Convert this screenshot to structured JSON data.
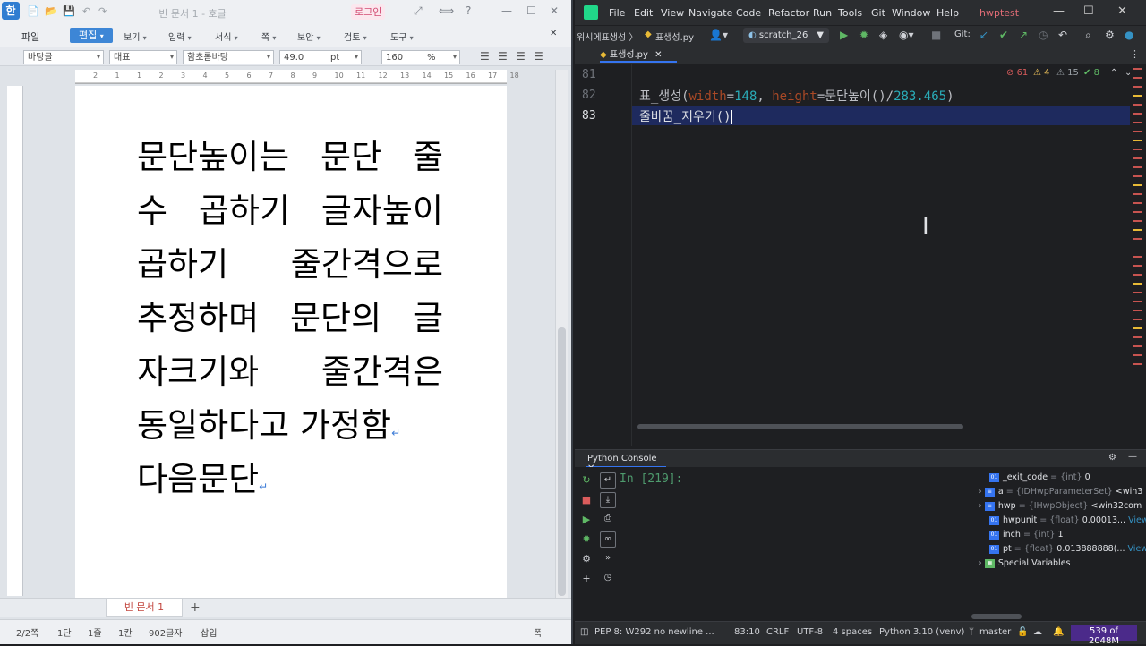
{
  "hwp": {
    "logo": "한",
    "quick_tools": [
      "📄",
      "📂",
      "💾",
      "↶",
      "↷"
    ],
    "doc_title": "빈 문서 1 - 호글",
    "login": "로그인",
    "title_controls": [
      "⤢",
      "⟺",
      "?",
      "—",
      "☐",
      "✕"
    ],
    "menu": [
      "파일",
      "편집",
      "보기",
      "입력",
      "서식",
      "쪽",
      "보안",
      "검토",
      "도구"
    ],
    "toolbar": {
      "style": "바탕글",
      "lang": "대표",
      "font": "함초롬바탕",
      "size": "49.0",
      "size_unit": "pt",
      "zoom_line": "160",
      "zoom_unit": "%"
    },
    "ruler": [
      "2",
      "1",
      "1",
      "2",
      "3",
      "4",
      "5",
      "6",
      "7",
      "8",
      "9",
      "10",
      "11",
      "12",
      "13",
      "14",
      "15",
      "16",
      "17",
      "18"
    ],
    "paragraph1_lines": [
      "문단높이는 문단 줄",
      "수 곱하기 글자높이",
      "곱하기 줄간격으로",
      "추정하며 문단의 글",
      "자크기와 줄간격은",
      "동일하다고 가정함"
    ],
    "paragraph2": "다음문단",
    "para_mark": "↵",
    "tab": "빈 문서 1",
    "tab_add": "+",
    "status": {
      "page": "2/2쪽",
      "section": "1단",
      "line": "1줄",
      "col": "1칸",
      "chars": "902글자",
      "mode": "삽입",
      "width": "폭"
    }
  },
  "pycharm": {
    "menu": [
      "File",
      "Edit",
      "View",
      "Navigate",
      "Code",
      "Refactor",
      "Run",
      "Tools",
      "Git",
      "Window",
      "Help"
    ],
    "project": "hwptest",
    "title_controls": [
      "—",
      "☐",
      "✕"
    ],
    "breadcrumb": "위시에표생성 〉",
    "file_crumb": "표생성.py",
    "run_config": "scratch_26",
    "git_label": "Git:",
    "tab": "표생성.py",
    "tab_close": "✕",
    "issues": {
      "errors": "61",
      "warnings": "4",
      "weak": "15",
      "ok": "8"
    },
    "lines": [
      {
        "num": "81"
      },
      {
        "num": "82"
      },
      {
        "num": "83"
      }
    ],
    "code82": {
      "func": "표_생성(",
      "p1": "width",
      "eq1": "=",
      "v1": "148",
      "comma": ", ",
      "p2": "height",
      "eq2": "=",
      "call": "문단높이()/",
      "v2": "283.465",
      "close": ")"
    },
    "code83": "줄바꿈_지우기()",
    "console": {
      "tab": "Python Console",
      "prompt": "In [219]:"
    },
    "variables": [
      {
        "name": "_exit_code",
        "type": "= {int}",
        "value": "0",
        "view": ""
      },
      {
        "name": "a",
        "type": "= {IDHwpParameterSet}",
        "value": "<win3",
        "view": ""
      },
      {
        "name": "hwp",
        "type": "= {IHwpObject}",
        "value": "<win32com",
        "view": ""
      },
      {
        "name": "hwpunit",
        "type": "= {float}",
        "value": "0.00013...",
        "view": "View"
      },
      {
        "name": "inch",
        "type": "= {int}",
        "value": "1",
        "view": ""
      },
      {
        "name": "pt",
        "type": "= {float}",
        "value": "0.013888888(...",
        "view": "View"
      },
      {
        "name": "Special Variables",
        "type": "",
        "value": "",
        "view": ""
      }
    ],
    "status": {
      "pep": "PEP 8: W292 no newline ...",
      "pos": "83:10",
      "eol": "CRLF",
      "enc": "UTF-8",
      "indent": "4 spaces",
      "interp": "Python 3.10 (venv)",
      "branch": "master",
      "memory": "539 of 2048M"
    }
  }
}
